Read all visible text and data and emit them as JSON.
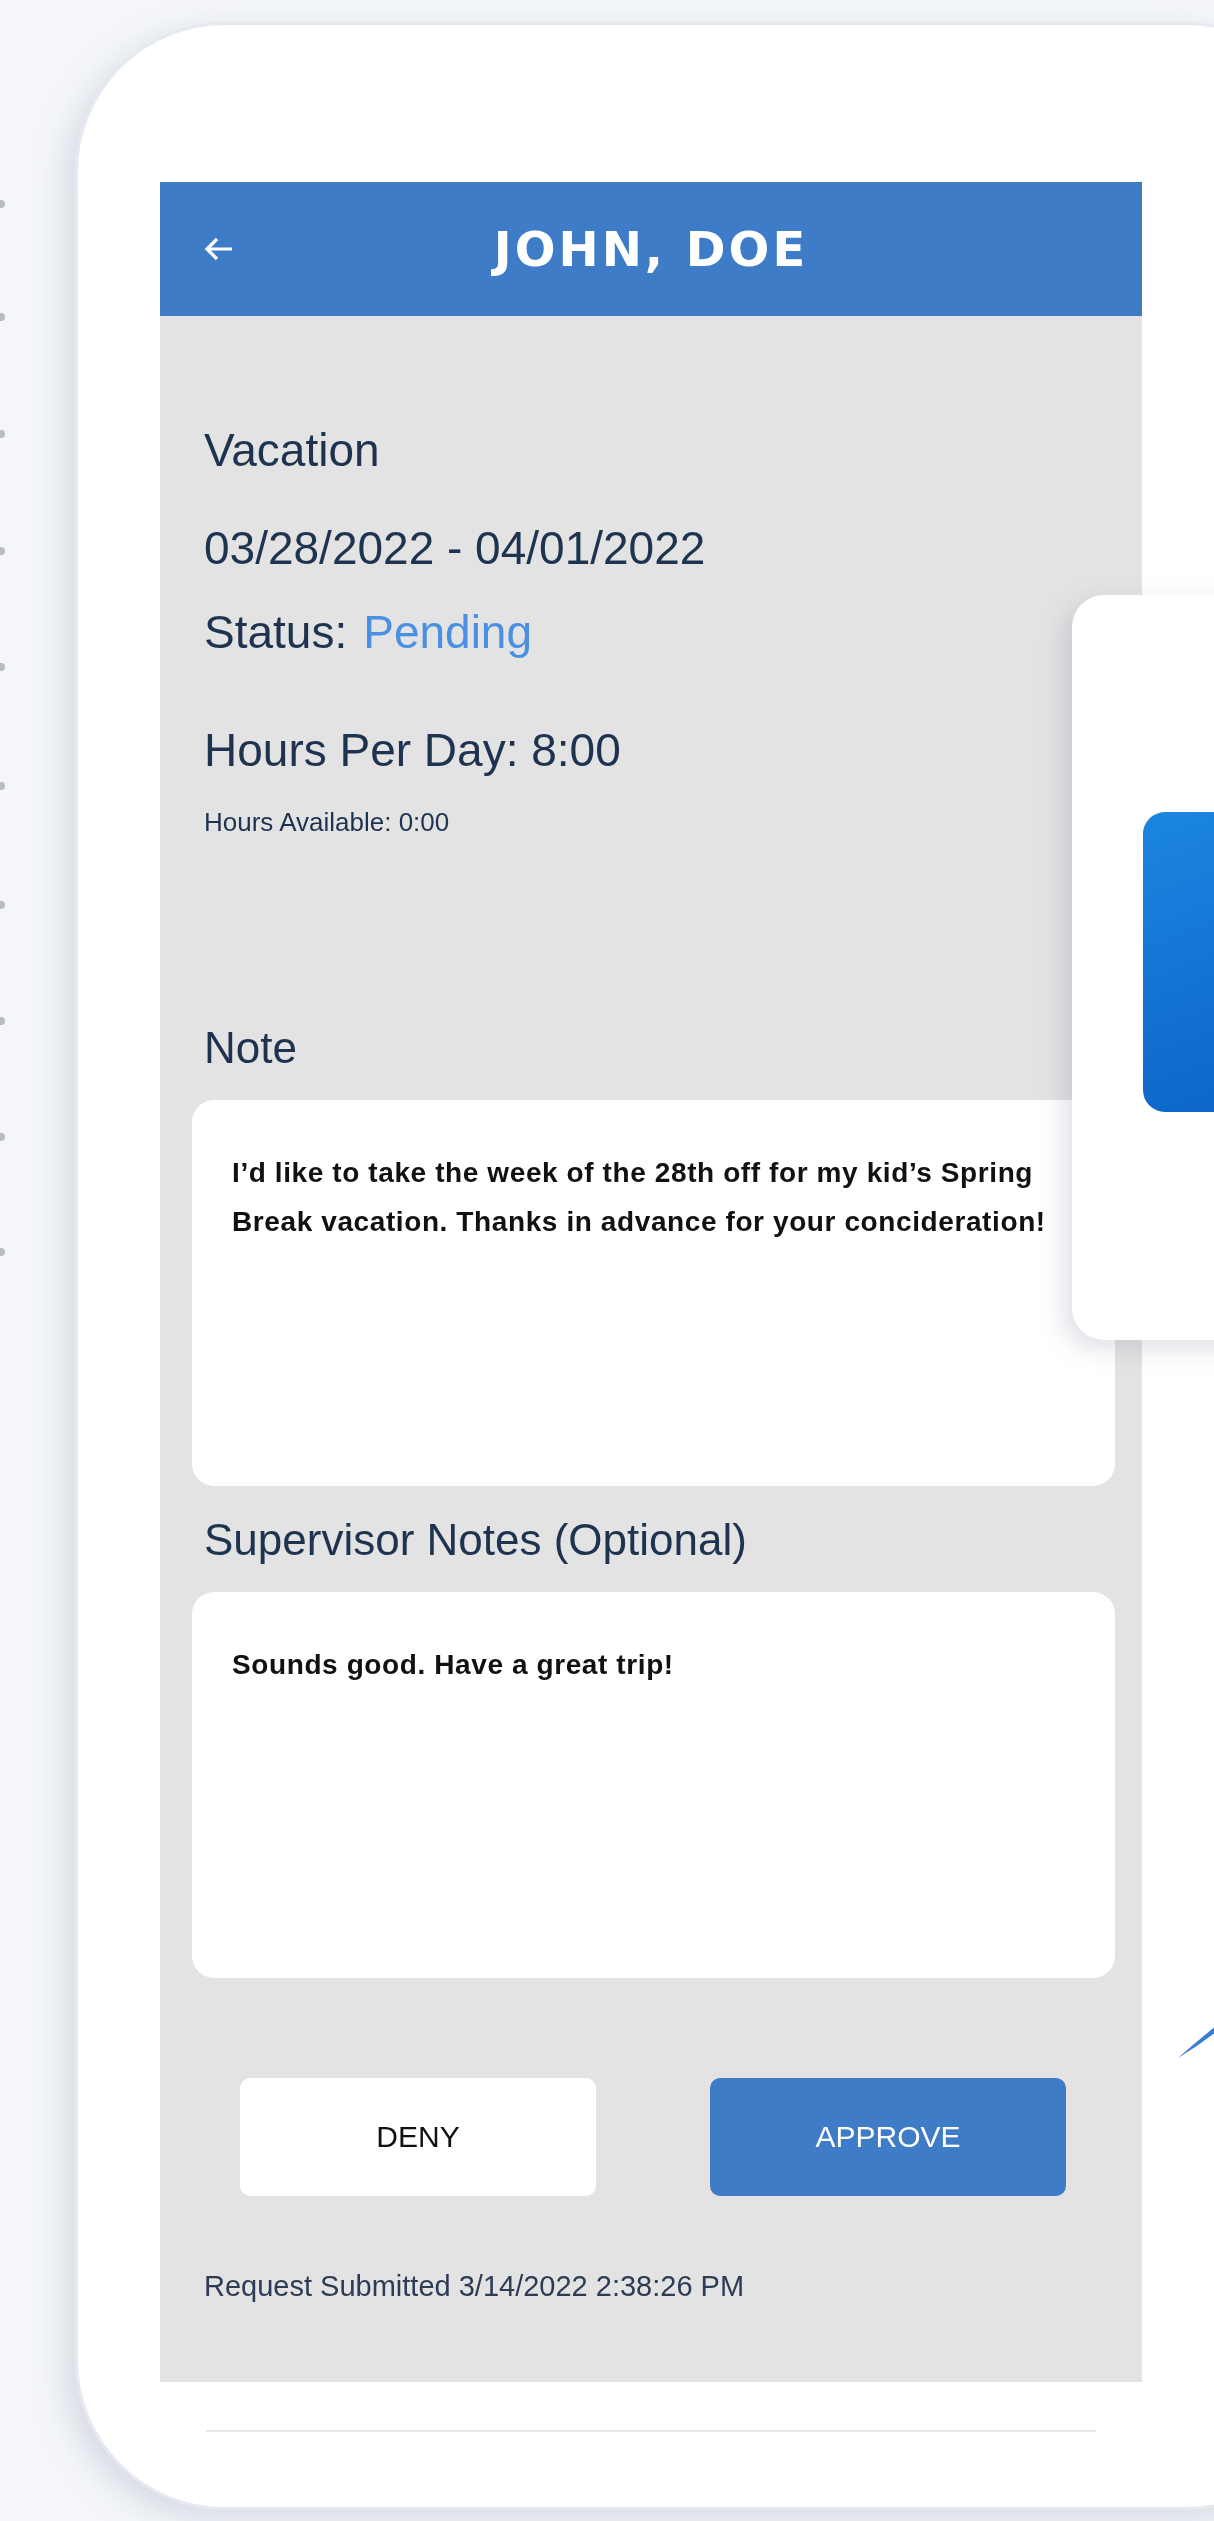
{
  "header": {
    "title": "JOHN, DOE"
  },
  "request": {
    "type": "Vacation",
    "date_range": "03/28/2022 - 04/01/2022",
    "status_label": "Status:",
    "status": {
      "value": "Pending",
      "kind": "pending"
    },
    "hours_per_day": "Hours Per Day: 8:00",
    "hours_available": "Hours Available: 0:00"
  },
  "note": {
    "label": "Note",
    "value": "I’d like to take the week of the 28th off for my kid’s Spring Break vacation. Thanks in advance for your concideration!"
  },
  "supervisor_notes": {
    "label": "Supervisor Notes  (Optional)",
    "value": "Sounds good. Have a great trip!"
  },
  "buttons": [
    {
      "label": "DENY",
      "kind": "secondary"
    },
    {
      "label": "APPROVE",
      "kind": "primary"
    }
  ],
  "footer": {
    "submitted": "Request Submitted 3/14/2022 2:38:26 PM"
  }
}
